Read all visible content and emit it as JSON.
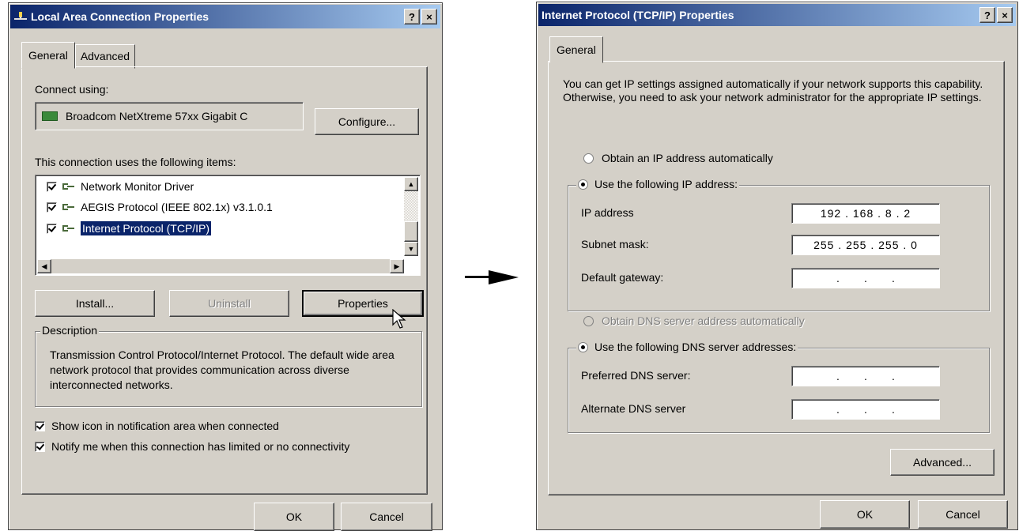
{
  "dialog1": {
    "title": "Local Area Connection Properties",
    "help_btn": "?",
    "close_btn": "×",
    "tabs": [
      "General",
      "Advanced"
    ],
    "connect_using_label": "Connect using:",
    "adapter_name": "Broadcom NetXtreme 57xx Gigabit C",
    "configure_btn": "Configure...",
    "items_label": "This connection uses the following items:",
    "items": [
      {
        "label": "Network Monitor Driver",
        "checked": true
      },
      {
        "label": "AEGIS Protocol (IEEE 802.1x) v3.1.0.1",
        "checked": true
      },
      {
        "label": "Internet Protocol (TCP/IP)",
        "checked": true,
        "selected": true
      }
    ],
    "install_btn": "Install...",
    "uninstall_btn": "Uninstall",
    "properties_btn": "Properties",
    "description_legend": "Description",
    "description_text": "Transmission Control Protocol/Internet Protocol. The default wide area network protocol that provides communication across diverse interconnected networks.",
    "show_icon_label": "Show icon in notification area when connected",
    "notify_label": "Notify me when this connection has limited or no connectivity",
    "ok_btn": "OK",
    "cancel_btn": "Cancel"
  },
  "arrow_icon": "right-arrow-icon",
  "dialog2": {
    "title": "Internet Protocol (TCP/IP) Properties",
    "help_btn": "?",
    "close_btn": "×",
    "tabs": [
      "General"
    ],
    "intro_text": "You can get IP settings assigned automatically if your network supports this capability. Otherwise, you need to ask your network administrator for the appropriate IP settings.",
    "obtain_ip_auto": "Obtain an IP address automatically",
    "use_following_ip": "Use the following IP address:",
    "ip_address_label": "IP address",
    "ip_address_value": "192 . 168 .   8  .   2",
    "subnet_mask_label": "Subnet mask:",
    "subnet_mask_value": "255 . 255 . 255 .  0",
    "gateway_label": "Default gateway:",
    "gateway_value": ".        .        .",
    "obtain_dns_auto": "Obtain DNS server address automatically",
    "use_following_dns": "Use the following DNS server addresses:",
    "preferred_dns_label": "Preferred DNS server:",
    "preferred_dns_value": ".        .        .",
    "alternate_dns_label": "Alternate DNS server",
    "alternate_dns_value": ".        .        .",
    "advanced_btn": "Advanced...",
    "ok_btn": "OK",
    "cancel_btn": "Cancel"
  },
  "colors": {
    "titlebar_start": "#0a246a",
    "titlebar_end": "#a6caf0",
    "face": "#d4d0c8",
    "selection": "#0a246a"
  }
}
